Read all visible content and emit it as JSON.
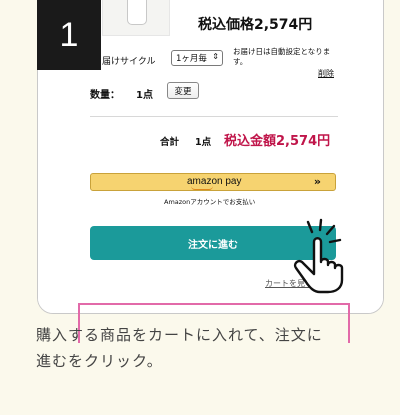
{
  "step": {
    "number": "1"
  },
  "product": {
    "price_top": "税込価格2,574円"
  },
  "delivery": {
    "cycle_label": "届けサイクル",
    "cycle_select_value": "1ヶ月毎",
    "cycle_note": "お届け日は自動設定となります。",
    "delete_link": "削除"
  },
  "quantity": {
    "label": "数量：",
    "value": "1点",
    "change_button": "変更"
  },
  "total": {
    "label": "合計",
    "qty": "1点",
    "amount": "税込金額2,574円"
  },
  "amazon_pay": {
    "logo_text": "amazon pay",
    "arrows": "»",
    "caption": "Amazonアカウントでお支払い"
  },
  "order_button": {
    "label": "注文に進む"
  },
  "cart_link": {
    "label": "カートを見る"
  },
  "caption": {
    "line1": "購入する商品をカートに入れて、注文に",
    "line2": "進むをクリック。"
  },
  "colors": {
    "background": "#fbf9ec",
    "accent_price": "#c0154a",
    "order_button": "#1b9a9a",
    "amazon_button": "#f6d370",
    "highlight_box": "#e26aa9"
  },
  "icons": [
    "bottle-icon",
    "hand-pointer-icon",
    "chevron-updown-icon"
  ]
}
